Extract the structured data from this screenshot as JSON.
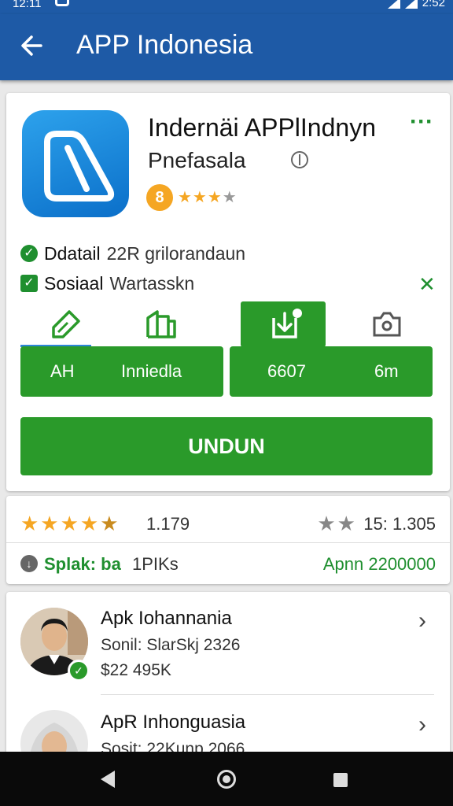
{
  "status_bar": {
    "time": "12:11",
    "clock_right": "2:52"
  },
  "app_bar": {
    "title": "APP Indonesia"
  },
  "app": {
    "name": "Indernäi APPlIndnyn",
    "developer": "Pnefasala",
    "age_badge": "8",
    "rating_stars": {
      "filled": "★★★",
      "empty": "★"
    },
    "icon": "app-logo-icon"
  },
  "features": [
    {
      "bold": "Ddatail",
      "text": "22R grilorandaun"
    },
    {
      "bold": "Sosiaal",
      "text": "Wartasskn"
    }
  ],
  "tabs": [
    "edit-icon",
    "building-icon",
    "download-icon",
    "camera-icon"
  ],
  "info_buttons": {
    "left": {
      "a": "AH",
      "b": "Inniedla"
    },
    "right": {
      "a": "6607",
      "b": "6m"
    }
  },
  "install": {
    "label": "UNDUN"
  },
  "stats": {
    "stars": "★★★★",
    "half_star": "★",
    "rating_count": "1.179",
    "grey_stars": "★★",
    "reviews": "15: 1.305",
    "size_label": "Splak: ba",
    "size_value": "1PIKs",
    "price": "Apnn 2200000"
  },
  "list": [
    {
      "title": "Apk Iohannania",
      "subtitle": "Sonil: SlarSkj 2326",
      "meta": "$22 495K"
    },
    {
      "title": "ApR Inhonguasia",
      "subtitle": "Sosit: 22Kunp 2066",
      "meta": ""
    }
  ],
  "colors": {
    "primary": "#1e5aa6",
    "accent_green": "#2a9a2a",
    "star": "#f5a623"
  }
}
